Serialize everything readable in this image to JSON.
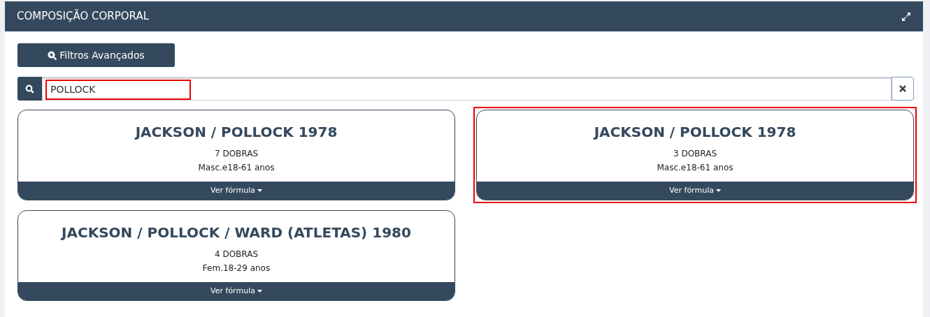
{
  "panel": {
    "title": "COMPOSIÇÃO CORPORAL"
  },
  "filter_button": {
    "label": "Filtros Avançados"
  },
  "search": {
    "value": "POLLOCK",
    "highlighted": true
  },
  "cards": [
    {
      "title": "JACKSON / POLLOCK 1978",
      "folds": "7 DOBRAS",
      "group": "Masc.e18-61 anos",
      "action": "Ver fórmula",
      "highlighted": false
    },
    {
      "title": "JACKSON / POLLOCK 1978",
      "folds": "3 DOBRAS",
      "group": "Masc.e18-61 anos",
      "action": "Ver fórmula",
      "highlighted": true
    },
    {
      "title": "JACKSON / POLLOCK / WARD (ATLETAS) 1980",
      "folds": "4 DOBRAS",
      "group": "Fem.18-29 anos",
      "action": "Ver fórmula",
      "highlighted": false
    }
  ]
}
